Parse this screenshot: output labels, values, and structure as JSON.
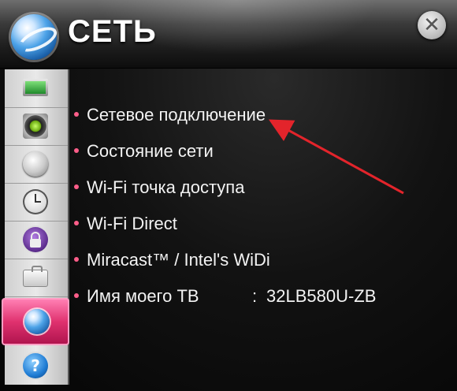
{
  "header": {
    "title": "СЕТЬ",
    "icon": "network-globe-icon",
    "close_glyph": "✕"
  },
  "sidebar": {
    "items": [
      {
        "id": "picture",
        "icon": "picture-icon"
      },
      {
        "id": "sound",
        "icon": "speaker-icon"
      },
      {
        "id": "channels",
        "icon": "satellite-dish-icon"
      },
      {
        "id": "time",
        "icon": "clock-icon"
      },
      {
        "id": "lock",
        "icon": "lock-icon"
      },
      {
        "id": "option",
        "icon": "suitcase-icon"
      },
      {
        "id": "network",
        "icon": "globe-icon",
        "active": true
      },
      {
        "id": "support",
        "icon": "help-icon",
        "glyph": "?"
      }
    ]
  },
  "menu": {
    "items": [
      {
        "label": "Сетевое подключение"
      },
      {
        "label": "Состояние сети"
      },
      {
        "label": "Wi-Fi точка доступа"
      },
      {
        "label": "Wi-Fi Direct"
      },
      {
        "label": "Miracast™ / Intel's WiDi"
      }
    ],
    "tv_name": {
      "label": "Имя моего ТВ",
      "separator": ":",
      "value": "32LB580U-ZB"
    }
  },
  "annotation": {
    "arrow_color": "#e3242b"
  },
  "colors": {
    "accent": "#e0326f",
    "bullet": "#ff5e8a",
    "text": "#f3f3f3",
    "background": "#0a0a0a"
  }
}
